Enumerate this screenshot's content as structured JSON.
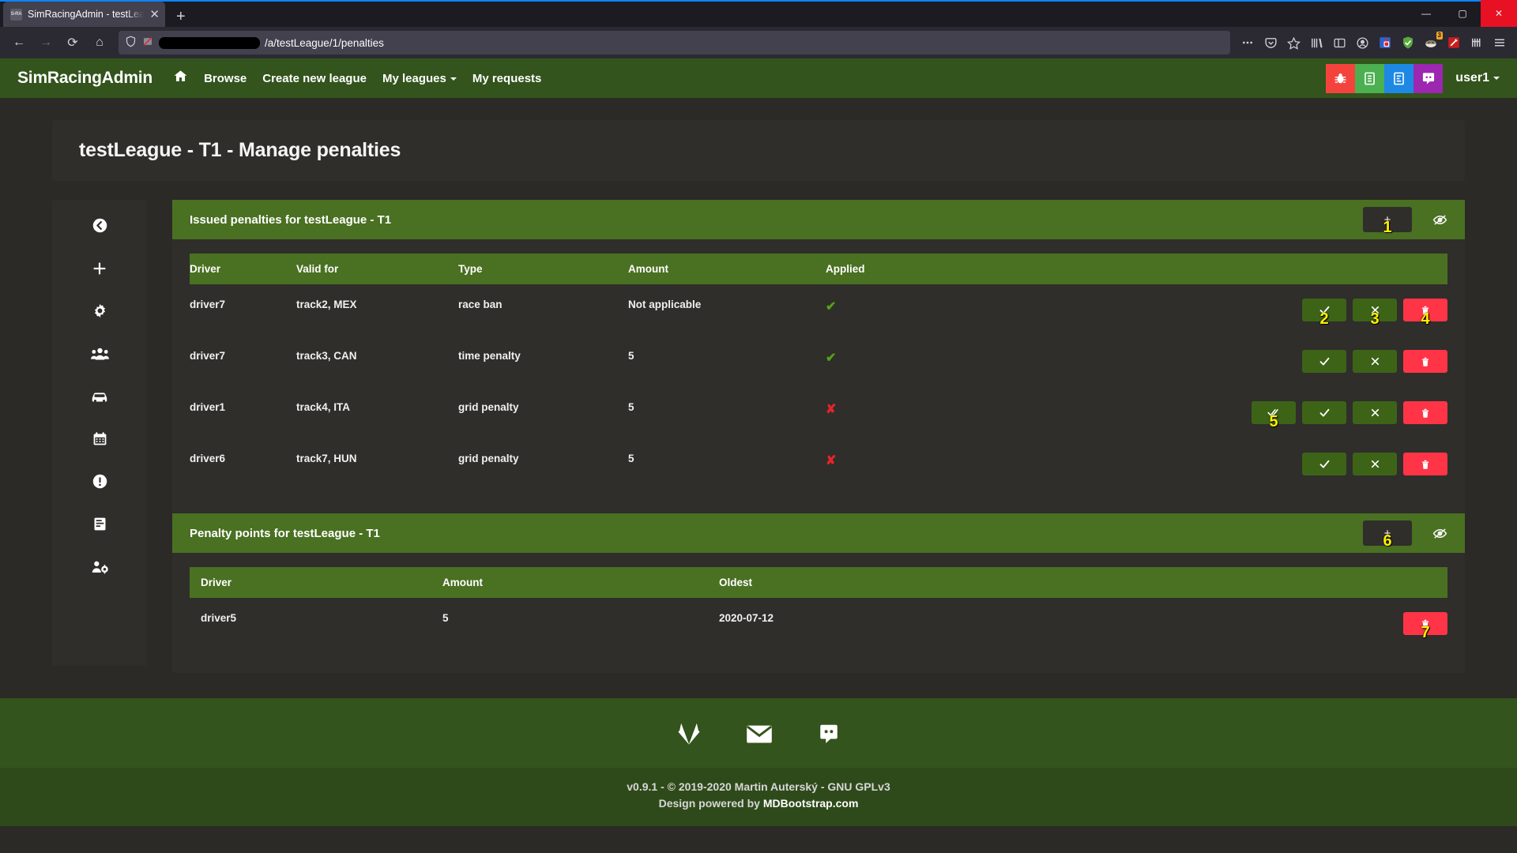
{
  "browser": {
    "tab": {
      "favicon_label": "S-RA",
      "title": "SimRacingAdmin - testLeague -",
      "close_icon": "✕"
    },
    "new_tab_icon": "+",
    "window_controls": {
      "minimize": "—",
      "maximize": "▢",
      "close": "✕"
    },
    "nav": {
      "back": "←",
      "forward": "→",
      "reload": "⟳",
      "home": "⌂"
    },
    "url": {
      "suffix": "/a/testLeague/1/penalties",
      "shield_icon": "shield-icon",
      "redacted": true
    },
    "extension_badge": "3"
  },
  "navbar": {
    "brand": "SimRacingAdmin",
    "links": [
      {
        "label": "Browse",
        "icon": null
      },
      {
        "label": "Create new league",
        "icon": null
      },
      {
        "label": "My leagues",
        "icon": "caret-down"
      },
      {
        "label": "My requests",
        "icon": null
      }
    ],
    "home_icon": "home-icon",
    "quick_buttons": [
      {
        "name": "bug-report",
        "color": "#f4433c",
        "icon": "bug"
      },
      {
        "name": "changelog",
        "color": "#4caf50",
        "icon": "list"
      },
      {
        "name": "survey",
        "color": "#1e88e5",
        "icon": "form"
      },
      {
        "name": "discord",
        "color": "#9c27b0",
        "icon": "discord"
      }
    ],
    "user": {
      "label": "user1",
      "caret": "▾"
    }
  },
  "page_title": "testLeague - T1 - Manage penalties",
  "sidebar": {
    "items": [
      {
        "name": "back",
        "icon": "arrow-circle-left-icon"
      },
      {
        "name": "add",
        "icon": "plus-icon"
      },
      {
        "name": "settings",
        "icon": "gear-icon"
      },
      {
        "name": "drivers",
        "icon": "users-icon"
      },
      {
        "name": "cars",
        "icon": "car-icon"
      },
      {
        "name": "calendar",
        "icon": "calendar-icon"
      },
      {
        "name": "penalties",
        "icon": "exclamation-circle-icon"
      },
      {
        "name": "results",
        "icon": "document-icon"
      },
      {
        "name": "manage-users",
        "icon": "users-cog-icon"
      }
    ]
  },
  "penalties_panel": {
    "title": "Issued penalties for testLeague - T1",
    "add_button_label": "+",
    "add_button_annotation": "1",
    "hide_icon": "eye-slash-icon",
    "columns": [
      "Driver",
      "Valid for",
      "Type",
      "Amount",
      "Applied"
    ],
    "rows": [
      {
        "driver": "driver7",
        "valid_for": "track2, MEX",
        "type": "race ban",
        "amount": "Not applicable",
        "applied": "yes",
        "actions": [
          {
            "name": "approve",
            "icon": "check",
            "style": "green",
            "annotation": "2"
          },
          {
            "name": "reject",
            "icon": "times",
            "style": "green",
            "annotation": "3"
          },
          {
            "name": "delete",
            "icon": "trash",
            "style": "red",
            "annotation": "4"
          }
        ]
      },
      {
        "driver": "driver7",
        "valid_for": "track3, CAN",
        "type": "time penalty",
        "amount": "5",
        "applied": "yes",
        "actions": [
          {
            "name": "approve",
            "icon": "check",
            "style": "green",
            "annotation": ""
          },
          {
            "name": "reject",
            "icon": "times",
            "style": "green",
            "annotation": ""
          },
          {
            "name": "delete",
            "icon": "trash",
            "style": "red",
            "annotation": ""
          }
        ]
      },
      {
        "driver": "driver1",
        "valid_for": "track4, ITA",
        "type": "grid penalty",
        "amount": "5",
        "applied": "no",
        "actions": [
          {
            "name": "apply",
            "icon": "double-check",
            "style": "green",
            "annotation": "5"
          },
          {
            "name": "approve",
            "icon": "check",
            "style": "green",
            "annotation": ""
          },
          {
            "name": "reject",
            "icon": "times",
            "style": "green",
            "annotation": ""
          },
          {
            "name": "delete",
            "icon": "trash",
            "style": "red",
            "annotation": ""
          }
        ]
      },
      {
        "driver": "driver6",
        "valid_for": "track7, HUN",
        "type": "grid penalty",
        "amount": "5",
        "applied": "no",
        "actions": [
          {
            "name": "approve",
            "icon": "check",
            "style": "green",
            "annotation": ""
          },
          {
            "name": "reject",
            "icon": "times",
            "style": "green",
            "annotation": ""
          },
          {
            "name": "delete",
            "icon": "trash",
            "style": "red",
            "annotation": ""
          }
        ]
      }
    ],
    "applied_yes_mark": "✔",
    "applied_no_mark": "✘"
  },
  "points_panel": {
    "title": "Penalty points for testLeague - T1",
    "add_button_label": "+",
    "add_button_annotation": "6",
    "hide_icon": "eye-slash-icon",
    "columns": [
      "Driver",
      "Amount",
      "Oldest"
    ],
    "rows": [
      {
        "driver": "driver5",
        "amount": "5",
        "oldest": "2020-07-12",
        "actions": [
          {
            "name": "delete",
            "icon": "trash",
            "style": "red",
            "annotation": "7"
          }
        ]
      }
    ]
  },
  "footer": {
    "icons": [
      {
        "name": "gitlab-icon"
      },
      {
        "name": "email-icon"
      },
      {
        "name": "discord-icon"
      }
    ],
    "copyright": "v0.9.1 - © 2019-2020 Martin Auterský - GNU GPLv3",
    "design_prefix": "Design powered by ",
    "design_link": "MDBootstrap.com"
  },
  "colors": {
    "brand_green": "#33541c",
    "panel_head_green": "#4a7022",
    "btn_green": "#3d6317",
    "btn_red": "#ff3547",
    "annotation_yellow": "#ffef00",
    "page_bg": "#2b2a26",
    "card_bg": "#2f2e2b"
  }
}
